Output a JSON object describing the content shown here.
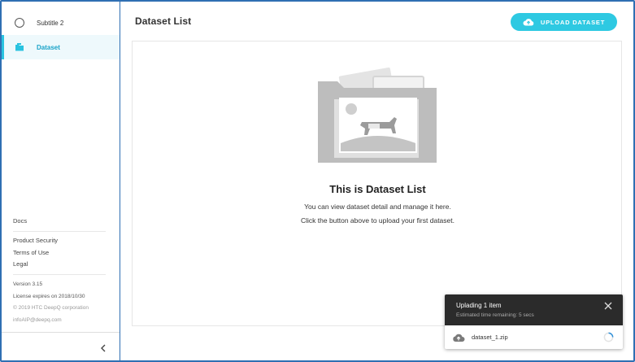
{
  "sidebar": {
    "items": [
      {
        "label": "Subtitle 2",
        "icon": "circle-icon"
      },
      {
        "label": "Dataset",
        "icon": "folder-icon",
        "active": true
      }
    ],
    "docs_label": "Docs",
    "links": [
      "Product Security",
      "Terms of Use",
      "Legal"
    ],
    "version": "Version 3.15",
    "license": "License expires on 2018/10/30",
    "copyright": "© 2019 HTC DeepQ corporation",
    "email": "infoAIP@deepq.com",
    "collapse_icon": "chevron-left-icon"
  },
  "header": {
    "title": "Dataset List",
    "upload_label": "UPLOAD DATASET",
    "upload_icon": "cloud-upload-icon"
  },
  "empty_state": {
    "illustration_icon": "folder-with-photo-icon",
    "title": "This is Dataset List",
    "line1": "You can view dataset detail and manage it here.",
    "line2": "Click the button above to upload your first dataset."
  },
  "upload_toast": {
    "title": "Uplading 1 item",
    "subtitle": "Estimated time remaining: 5 secs",
    "file_name": "dataset_1.zip",
    "file_icon": "cloud-upload-icon",
    "close_icon": "close-icon",
    "progress_icon": "spinner-icon"
  },
  "colors": {
    "accent": "#2ec9e2",
    "frame_border": "#2f6fb3",
    "toast_header": "#2b2b2b"
  }
}
